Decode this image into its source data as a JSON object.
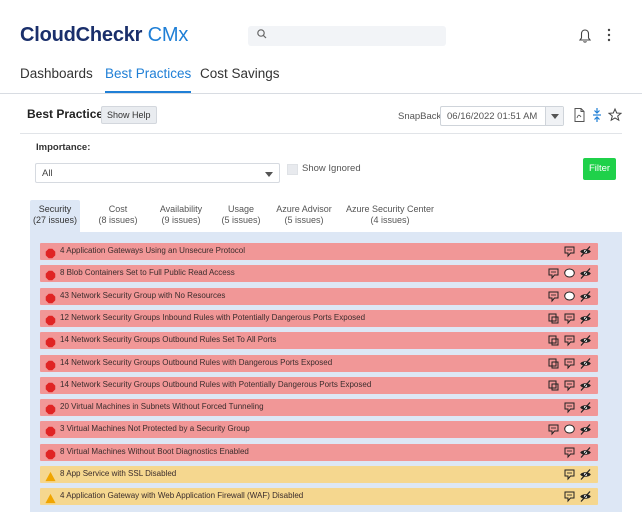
{
  "app": {
    "logo_main": "CloudCheckr",
    "logo_sub": "CMx"
  },
  "search": {
    "placeholder": ""
  },
  "nav": {
    "tabs": [
      {
        "label": "Dashboards",
        "active": false
      },
      {
        "label": "Best Practices",
        "active": true
      },
      {
        "label": "Cost Savings",
        "active": false
      }
    ]
  },
  "section": {
    "title": "Best Practices",
    "help_label": "Show Help",
    "snapback_label": "SnapBack:",
    "snapback_value": "06/16/2022 01:51 AM"
  },
  "filters": {
    "importance_label": "Importance:",
    "importance_value": "All",
    "show_ignored_label": "Show Ignored",
    "filter_label": "Filter"
  },
  "categories": [
    {
      "name": "Security",
      "count": "(27 issues)",
      "active": true
    },
    {
      "name": "Cost",
      "count": "(8 issues)",
      "active": false
    },
    {
      "name": "Availability",
      "count": "(9 issues)",
      "active": false
    },
    {
      "name": "Usage",
      "count": "(5 issues)",
      "active": false
    },
    {
      "name": "Azure Advisor",
      "count": "(5 issues)",
      "active": false
    },
    {
      "name": "Azure Security Center",
      "count": "(4 issues)",
      "active": false
    }
  ],
  "issues": [
    {
      "text": "4 Application Gateways Using an Unsecure Protocol",
      "severity": "high"
    },
    {
      "text": "8 Blob Containers Set to Full Public Read Access",
      "severity": "high"
    },
    {
      "text": "43 Network Security Group with No Resources",
      "severity": "high"
    },
    {
      "text": "12 Network Security Groups Inbound Rules with Potentially Dangerous Ports Exposed",
      "severity": "high"
    },
    {
      "text": "14 Network Security Groups Outbound Rules Set To All Ports",
      "severity": "high"
    },
    {
      "text": "14 Network Security Groups Outbound Rules with Dangerous Ports Exposed",
      "severity": "high"
    },
    {
      "text": "14 Network Security Groups Outbound Rules with Potentially Dangerous Ports Exposed",
      "severity": "high"
    },
    {
      "text": "20 Virtual Machines in Subnets Without Forced Tunneling",
      "severity": "high"
    },
    {
      "text": "3 Virtual Machines Not Protected by a Security Group",
      "severity": "high"
    },
    {
      "text": "8 Virtual Machines Without Boot Diagnostics Enabled",
      "severity": "high"
    },
    {
      "text": "8 App Service with SSL Disabled",
      "severity": "medium"
    },
    {
      "text": "4 Application Gateway with Web Application Firewall (WAF) Disabled",
      "severity": "medium"
    }
  ],
  "colors": {
    "accent": "#1f7fd6",
    "brand": "#1a2f6b",
    "high": "#f19797",
    "medium": "#f5d78f",
    "filter": "#1fd14a",
    "tab_active": "#dde7f5"
  }
}
